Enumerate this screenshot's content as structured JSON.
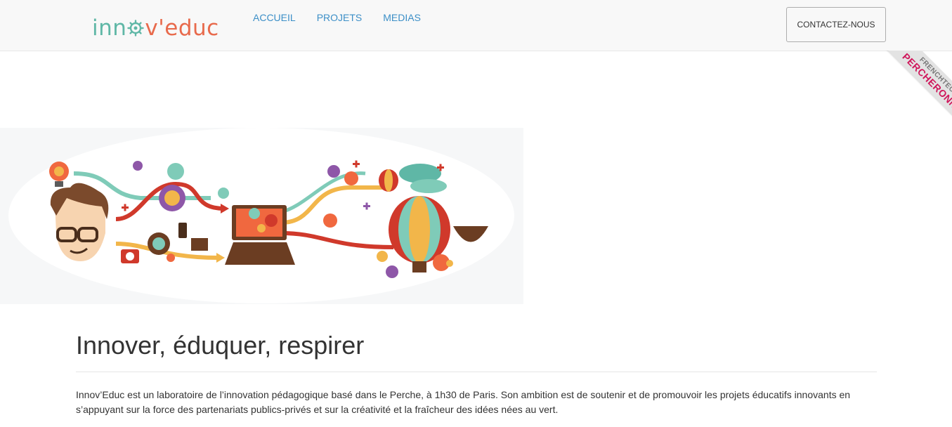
{
  "brand": {
    "logo_part1": "inn",
    "logo_part2": "v'educ"
  },
  "nav": {
    "items": [
      {
        "label": "ACCUEIL"
      },
      {
        "label": "PROJETS"
      },
      {
        "label": "MEDIAS"
      }
    ],
    "contact_label": "CONTACTEZ-NOUS"
  },
  "ribbon": {
    "line1": "FRENCHTECH",
    "line2": "PERCHERONNE"
  },
  "main": {
    "title": "Innover, éduquer, respirer",
    "paragraph": "Innov’Educ est un laboratoire de l’innovation pédagogique basé dans le Perche, à 1h30 de Paris. Son ambition est de soutenir et de promouvoir les projets éducatifs innovants en s’appuyant sur la force des partenariats publics-privés et sur la créativité et la fraîcheur des idées nées au vert."
  },
  "colors": {
    "navbar_bg": "#f8f8f8",
    "link": "#3c8fc7",
    "logo_teal": "#5fb7a6",
    "logo_orange": "#e86a4c",
    "ribbon_pink": "#d0165b"
  }
}
